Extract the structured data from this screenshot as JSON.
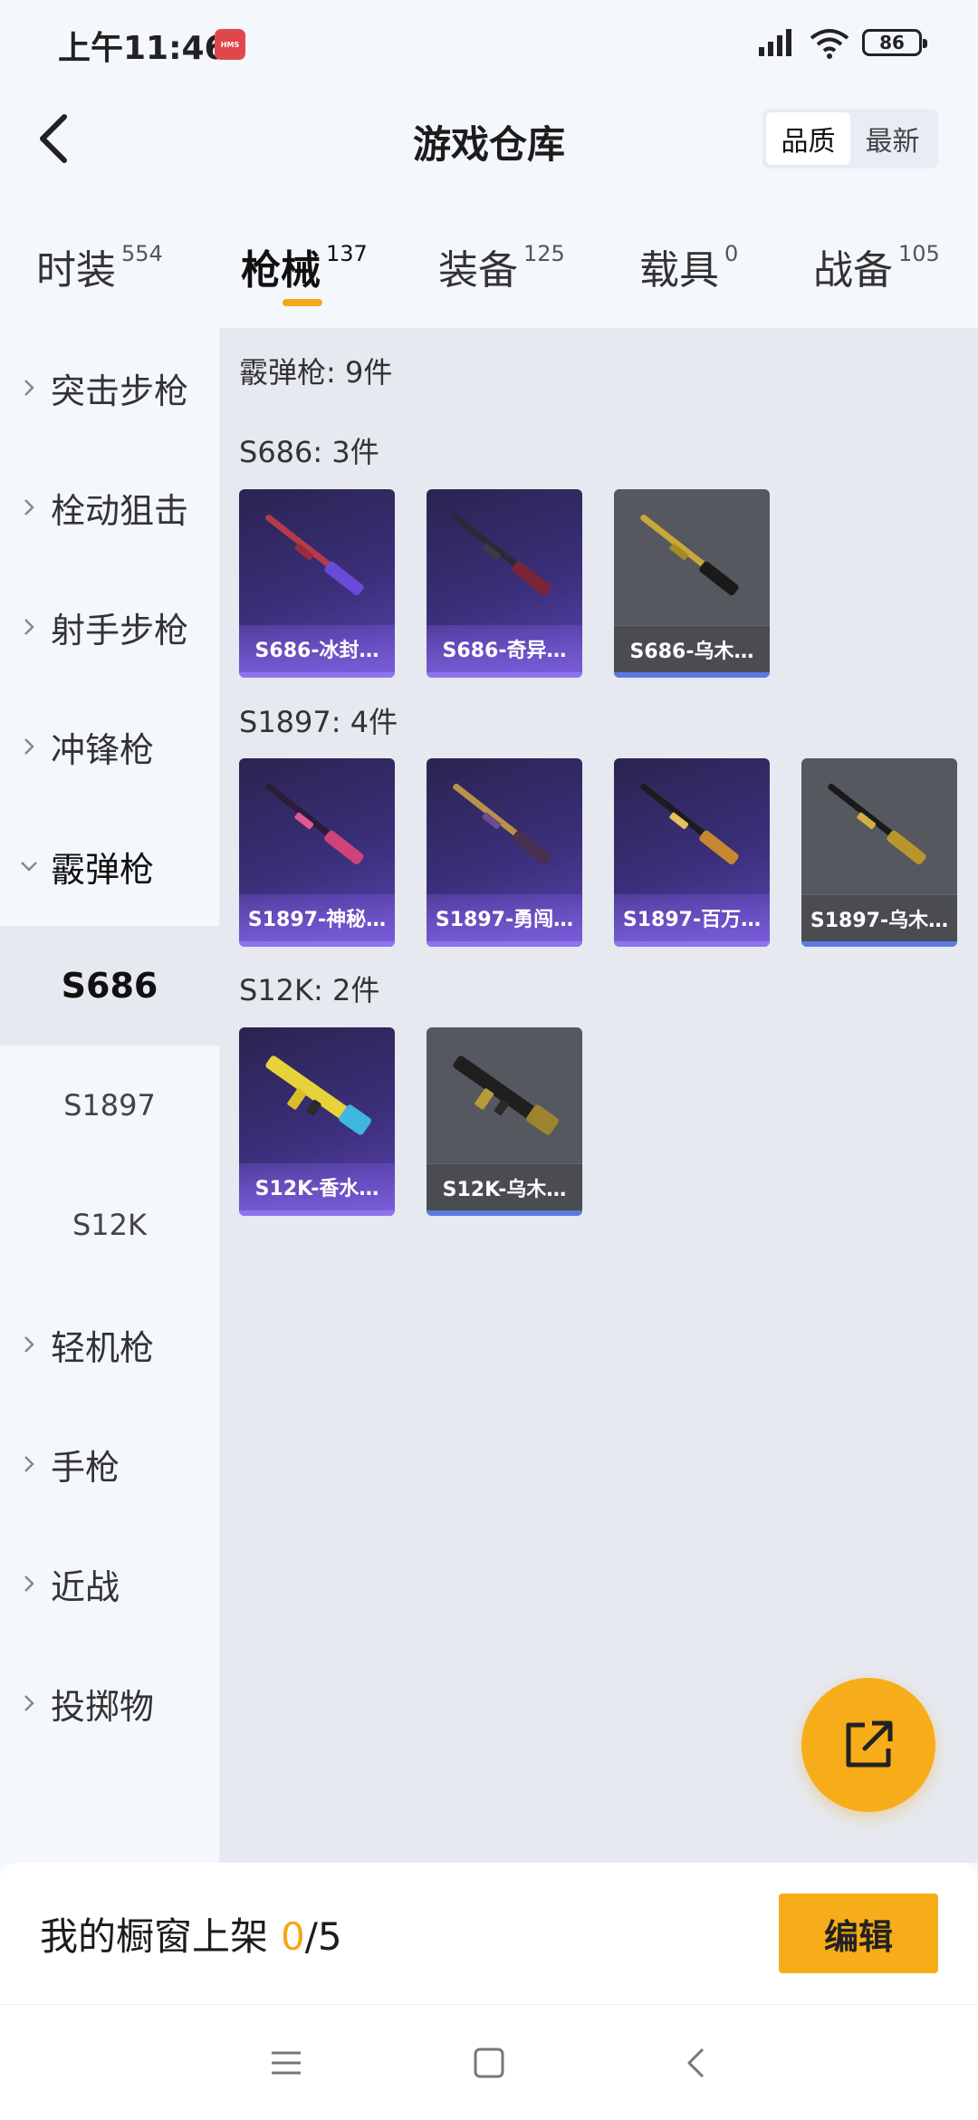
{
  "status_bar": {
    "time": "上午11:46",
    "hms_badge": "HMS",
    "battery": "86"
  },
  "header": {
    "back_icon": "chevron-left-icon",
    "title": "游戏仓库",
    "sort_options": [
      "品质",
      "最新"
    ],
    "sort_active": "品质"
  },
  "tabs": [
    {
      "label": "时装",
      "count": "554"
    },
    {
      "label": "枪械",
      "count": "137",
      "active": true
    },
    {
      "label": "装备",
      "count": "125"
    },
    {
      "label": "载具",
      "count": "0"
    },
    {
      "label": "战备",
      "count": "105"
    }
  ],
  "sidebar": {
    "items": [
      "突击步枪",
      "栓动狙击",
      "射手步枪",
      "冲锋枪",
      "霰弹枪"
    ],
    "sub_items": [
      "S686",
      "S1897",
      "S12K"
    ],
    "items_after": [
      "轻机枪",
      "手枪",
      "近战",
      "投掷物"
    ]
  },
  "content": {
    "category_title": "霰弹枪: 9件",
    "groups": [
      {
        "title": "S686: 3件",
        "items": [
          {
            "name": "S686-冰封…",
            "rarity": "purple"
          },
          {
            "name": "S686-奇异…",
            "rarity": "purple"
          },
          {
            "name": "S686-乌木…",
            "rarity": "gray"
          }
        ]
      },
      {
        "title": "S1897: 4件",
        "items": [
          {
            "name": "S1897-神秘…",
            "rarity": "purple"
          },
          {
            "name": "S1897-勇闯…",
            "rarity": "purple"
          },
          {
            "name": "S1897-百万…",
            "rarity": "purple"
          },
          {
            "name": "S1897-乌木…",
            "rarity": "gray"
          }
        ]
      },
      {
        "title": "S12K: 2件",
        "items": [
          {
            "name": "S12K-香水…",
            "rarity": "purple"
          },
          {
            "name": "S12K-乌木…",
            "rarity": "gray"
          }
        ]
      }
    ]
  },
  "fab": {
    "icon": "share-external-icon"
  },
  "shelf": {
    "label": "我的橱窗上架",
    "current": "0",
    "separator": "/",
    "total": "5",
    "edit_label": "编辑"
  },
  "nav": {
    "icons": [
      "menu-icon",
      "home-square-icon",
      "back-triangle-icon"
    ]
  },
  "colors": {
    "accent": "#f7ad1a",
    "purple_card": "#3b2f7a",
    "gray_card": "#56585f"
  }
}
